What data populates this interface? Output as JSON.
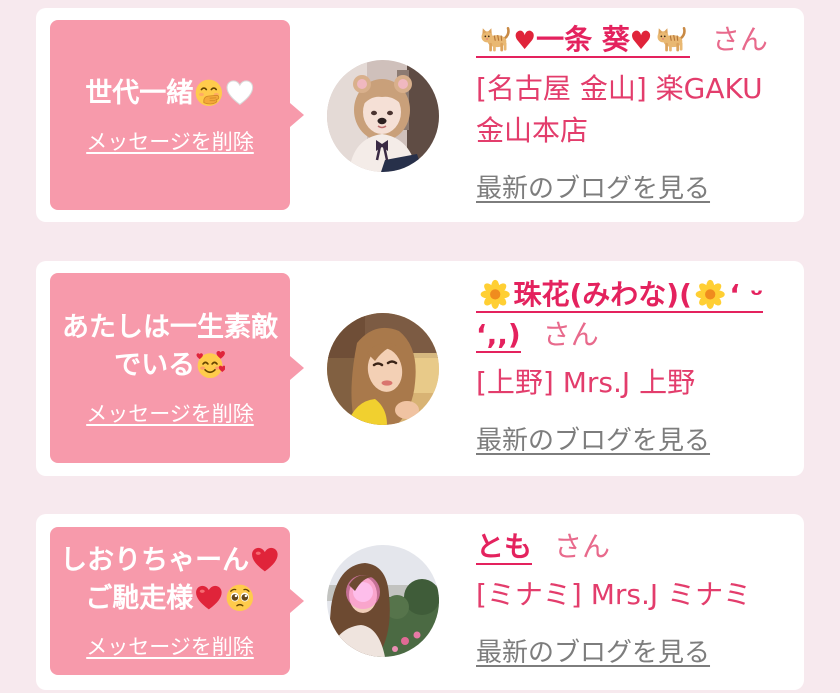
{
  "colors": {
    "page_background": "#f7e9ee",
    "card_background": "#ffffff",
    "bubble": "#f79aab",
    "name": "#e4225e",
    "shop": "#e33d6c",
    "honorific": "#e86a8c",
    "link_gray": "#7d7d7d",
    "heart_red": "#e0243a"
  },
  "cards": [
    {
      "message": [
        "世代一緒",
        "🤭",
        "🤍"
      ],
      "delete_label": "メッセージを削除",
      "name": [
        "🐈",
        "♥",
        "一条 葵",
        "♥",
        "🐈"
      ],
      "honorific": "さん",
      "shop": "[名古屋 金山] 楽GAKU 金山本店",
      "blog_label": "最新のブログを見る"
    },
    {
      "message": [
        "あたしは一生素敵",
        "でいる",
        "🥰"
      ],
      "delete_label": "メッセージを削除",
      "name": [
        "🌼",
        "珠花(みわな)(",
        "🌼",
        "‘ ᵕ",
        "‘,,)"
      ],
      "honorific": "さん",
      "shop": "[上野] Mrs.J 上野",
      "blog_label": "最新のブログを見る"
    },
    {
      "message": [
        "しおりちゃーん",
        "❤️",
        "ご馳走様",
        "❤️",
        "🥺"
      ],
      "delete_label": "メッセージを削除",
      "name": [
        "とも"
      ],
      "honorific": "さん",
      "shop": "[ミナミ] Mrs.J ミナミ",
      "blog_label": "最新のブログを見る"
    }
  ]
}
